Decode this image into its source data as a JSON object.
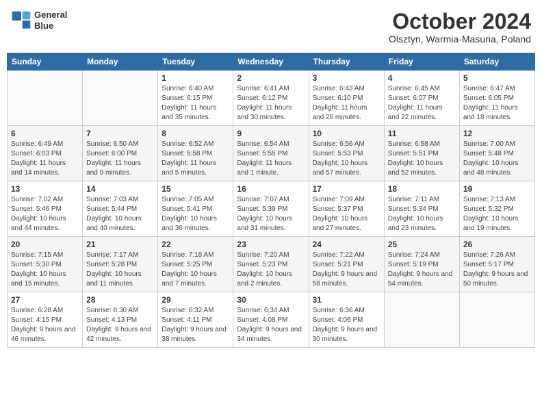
{
  "logo": {
    "line1": "General",
    "line2": "Blue"
  },
  "title": "October 2024",
  "subtitle": "Olsztyn, Warmia-Masuria, Poland",
  "weekdays": [
    "Sunday",
    "Monday",
    "Tuesday",
    "Wednesday",
    "Thursday",
    "Friday",
    "Saturday"
  ],
  "weeks": [
    [
      {
        "day": "",
        "info": ""
      },
      {
        "day": "",
        "info": ""
      },
      {
        "day": "1",
        "info": "Sunrise: 6:40 AM\nSunset: 6:15 PM\nDaylight: 11 hours and 35 minutes."
      },
      {
        "day": "2",
        "info": "Sunrise: 6:41 AM\nSunset: 6:12 PM\nDaylight: 11 hours and 30 minutes."
      },
      {
        "day": "3",
        "info": "Sunrise: 6:43 AM\nSunset: 6:10 PM\nDaylight: 11 hours and 26 minutes."
      },
      {
        "day": "4",
        "info": "Sunrise: 6:45 AM\nSunset: 6:07 PM\nDaylight: 11 hours and 22 minutes."
      },
      {
        "day": "5",
        "info": "Sunrise: 6:47 AM\nSunset: 6:05 PM\nDaylight: 11 hours and 18 minutes."
      }
    ],
    [
      {
        "day": "6",
        "info": "Sunrise: 6:49 AM\nSunset: 6:03 PM\nDaylight: 11 hours and 14 minutes."
      },
      {
        "day": "7",
        "info": "Sunrise: 6:50 AM\nSunset: 6:00 PM\nDaylight: 11 hours and 9 minutes."
      },
      {
        "day": "8",
        "info": "Sunrise: 6:52 AM\nSunset: 5:58 PM\nDaylight: 11 hours and 5 minutes."
      },
      {
        "day": "9",
        "info": "Sunrise: 6:54 AM\nSunset: 5:55 PM\nDaylight: 11 hours and 1 minute."
      },
      {
        "day": "10",
        "info": "Sunrise: 6:56 AM\nSunset: 5:53 PM\nDaylight: 10 hours and 57 minutes."
      },
      {
        "day": "11",
        "info": "Sunrise: 6:58 AM\nSunset: 5:51 PM\nDaylight: 10 hours and 52 minutes."
      },
      {
        "day": "12",
        "info": "Sunrise: 7:00 AM\nSunset: 5:48 PM\nDaylight: 10 hours and 48 minutes."
      }
    ],
    [
      {
        "day": "13",
        "info": "Sunrise: 7:02 AM\nSunset: 5:46 PM\nDaylight: 10 hours and 44 minutes."
      },
      {
        "day": "14",
        "info": "Sunrise: 7:03 AM\nSunset: 5:44 PM\nDaylight: 10 hours and 40 minutes."
      },
      {
        "day": "15",
        "info": "Sunrise: 7:05 AM\nSunset: 5:41 PM\nDaylight: 10 hours and 36 minutes."
      },
      {
        "day": "16",
        "info": "Sunrise: 7:07 AM\nSunset: 5:39 PM\nDaylight: 10 hours and 31 minutes."
      },
      {
        "day": "17",
        "info": "Sunrise: 7:09 AM\nSunset: 5:37 PM\nDaylight: 10 hours and 27 minutes."
      },
      {
        "day": "18",
        "info": "Sunrise: 7:11 AM\nSunset: 5:34 PM\nDaylight: 10 hours and 23 minutes."
      },
      {
        "day": "19",
        "info": "Sunrise: 7:13 AM\nSunset: 5:32 PM\nDaylight: 10 hours and 19 minutes."
      }
    ],
    [
      {
        "day": "20",
        "info": "Sunrise: 7:15 AM\nSunset: 5:30 PM\nDaylight: 10 hours and 15 minutes."
      },
      {
        "day": "21",
        "info": "Sunrise: 7:17 AM\nSunset: 5:28 PM\nDaylight: 10 hours and 11 minutes."
      },
      {
        "day": "22",
        "info": "Sunrise: 7:18 AM\nSunset: 5:25 PM\nDaylight: 10 hours and 7 minutes."
      },
      {
        "day": "23",
        "info": "Sunrise: 7:20 AM\nSunset: 5:23 PM\nDaylight: 10 hours and 2 minutes."
      },
      {
        "day": "24",
        "info": "Sunrise: 7:22 AM\nSunset: 5:21 PM\nDaylight: 9 hours and 58 minutes."
      },
      {
        "day": "25",
        "info": "Sunrise: 7:24 AM\nSunset: 5:19 PM\nDaylight: 9 hours and 54 minutes."
      },
      {
        "day": "26",
        "info": "Sunrise: 7:26 AM\nSunset: 5:17 PM\nDaylight: 9 hours and 50 minutes."
      }
    ],
    [
      {
        "day": "27",
        "info": "Sunrise: 6:28 AM\nSunset: 4:15 PM\nDaylight: 9 hours and 46 minutes."
      },
      {
        "day": "28",
        "info": "Sunrise: 6:30 AM\nSunset: 4:13 PM\nDaylight: 9 hours and 42 minutes."
      },
      {
        "day": "29",
        "info": "Sunrise: 6:32 AM\nSunset: 4:11 PM\nDaylight: 9 hours and 38 minutes."
      },
      {
        "day": "30",
        "info": "Sunrise: 6:34 AM\nSunset: 4:08 PM\nDaylight: 9 hours and 34 minutes."
      },
      {
        "day": "31",
        "info": "Sunrise: 6:36 AM\nSunset: 4:06 PM\nDaylight: 9 hours and 30 minutes."
      },
      {
        "day": "",
        "info": ""
      },
      {
        "day": "",
        "info": ""
      }
    ]
  ]
}
